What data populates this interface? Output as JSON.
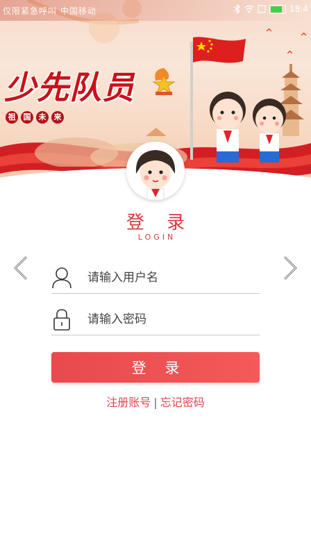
{
  "status_bar": {
    "carrier": "仅限紧急呼叫 中国移动",
    "wifi_icon": "wifi-icon",
    "bluetooth_icon": "bluetooth-icon",
    "battery_icon": "battery-icon",
    "time": "18:4"
  },
  "banner": {
    "title": "少先队员",
    "subtitle_chars": [
      "祖",
      "国",
      "未",
      "来"
    ]
  },
  "login": {
    "title": "登 录",
    "subtitle": "LOGIN",
    "username_placeholder": "请输入用户名",
    "password_placeholder": "请输入密码",
    "submit_label": "登 录",
    "register_link": "注册账号",
    "separator": "|",
    "forgot_link": "忘记密码"
  },
  "icons": {
    "left": "chevron-left-icon",
    "right": "chevron-right-icon",
    "user": "user-icon",
    "lock": "lock-icon"
  },
  "colors": {
    "brand_red": "#d9363a",
    "button_red": "#ef5253",
    "banner_red": "#c8121a"
  }
}
